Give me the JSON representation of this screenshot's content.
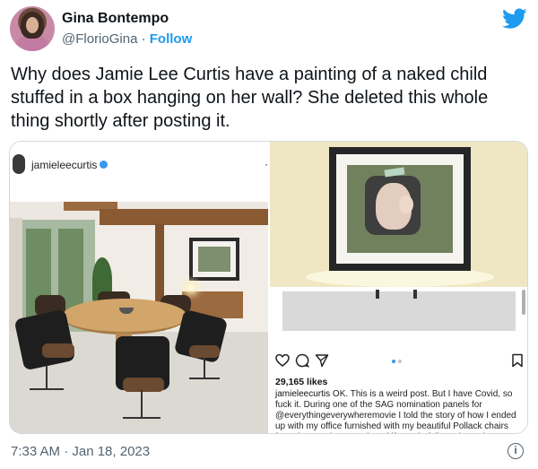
{
  "author": {
    "name": "Gina Bontempo",
    "handle": "@FlorioGina",
    "separator": "·",
    "follow_label": "Follow"
  },
  "icons": {
    "brand": "twitter-bird-icon",
    "info": "info-icon",
    "verified": "verified-badge-icon",
    "heart": "heart-icon",
    "comment": "comment-icon",
    "share": "send-icon",
    "bookmark": "bookmark-icon"
  },
  "colors": {
    "brand": "#1d9bf0",
    "text": "#0f1419",
    "muted": "#536471"
  },
  "tweet": {
    "text": "Why does Jamie Lee Curtis have a painting of a naked child stuffed in a box hanging on her wall? She deleted this whole thing shortly after posting it.",
    "timestamp": "7:33 AM · Jan 18, 2023"
  },
  "media": {
    "left": {
      "ig_username": "jamieleecurtis",
      "more_glyph": "·"
    },
    "right": {
      "likes": "29,165 likes",
      "caption_user": "jamieleecurtis",
      "caption_text": "OK. This is a weird post. But I have Covid, so fuck it. During one of the SAG nomination panels for @everythingeverywheremovie I told the story of how I ended up with my office furnished with my beautiful Pollack chairs from that movie. I mentioned if people followed me, that was",
      "carousel_total": 2,
      "carousel_active": 1
    }
  }
}
